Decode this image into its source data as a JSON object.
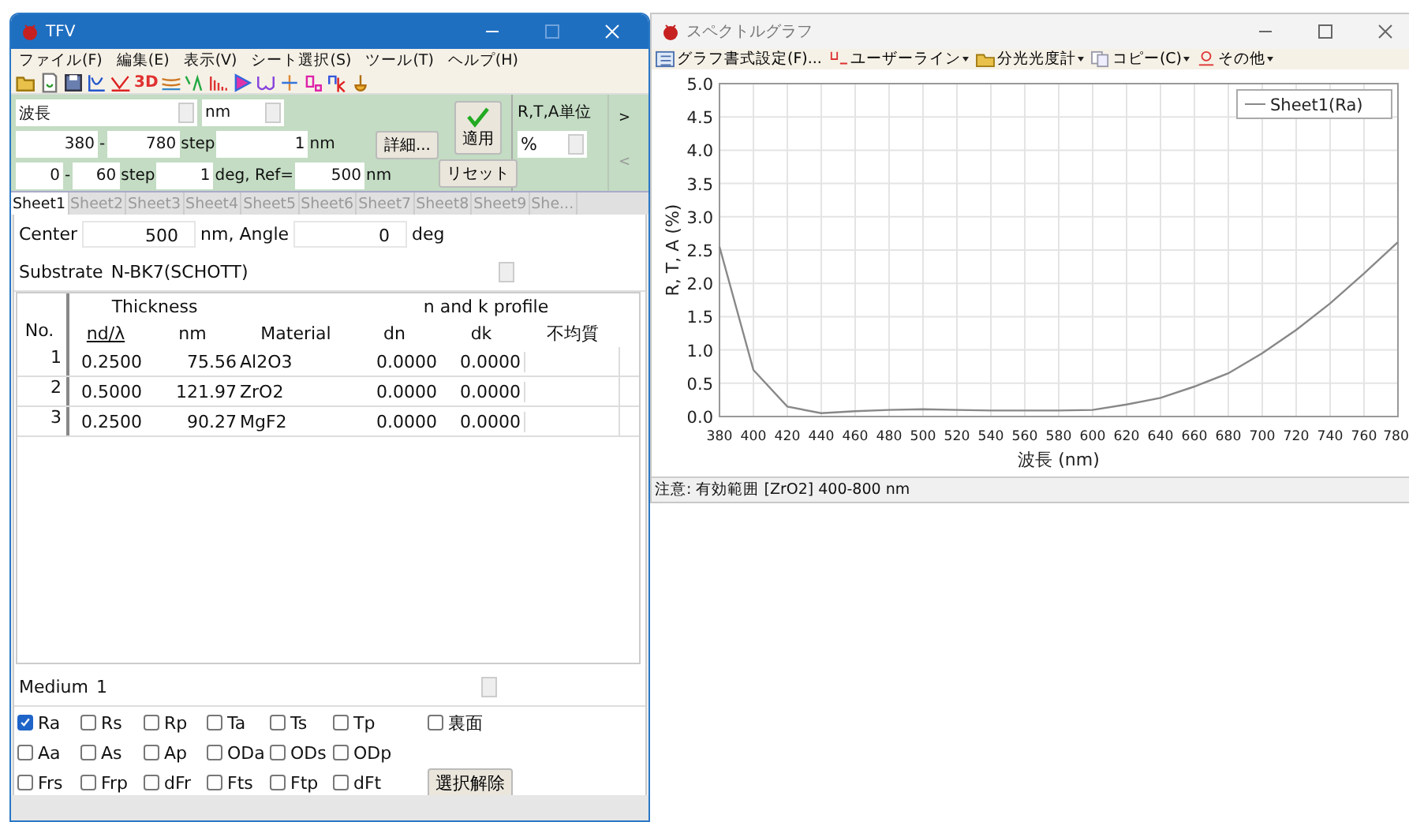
{
  "main_window": {
    "title": "TFV",
    "menu": [
      "ファイル(F)",
      "編集(E)",
      "表示(V)",
      "シート選択(S)",
      "ツール(T)",
      "ヘルプ(H)"
    ],
    "toolbar": {
      "text_icon": "3D"
    },
    "range_panel": {
      "axis_select": "波長",
      "unit_select": "nm",
      "from": "380",
      "dash_1": "-",
      "to": "780",
      "step_label_1": "step",
      "step": "1",
      "unit_1": "nm",
      "detail_button": "詳細...",
      "angle_from": "0",
      "dash_2": "-",
      "angle_to": "60",
      "step_label_2": "step",
      "angle_step": "1",
      "ref_label": "deg, Ref=",
      "ref": "500",
      "unit_2": "nm",
      "apply_button": "適用",
      "reset_button": "リセット",
      "units_label": "R,T,A単位",
      "units_select": "%",
      "expand_arrow": ">",
      "collapse_arrow": "<"
    },
    "tabs": [
      {
        "label": "Sheet1",
        "selected": true
      },
      {
        "label": "Sheet2",
        "selected": false
      },
      {
        "label": "Sheet3",
        "selected": false
      },
      {
        "label": "Sheet4",
        "selected": false
      },
      {
        "label": "Sheet5",
        "selected": false
      },
      {
        "label": "Sheet6",
        "selected": false
      },
      {
        "label": "Sheet7",
        "selected": false
      },
      {
        "label": "Sheet8",
        "selected": false
      },
      {
        "label": "Sheet9",
        "selected": false
      },
      {
        "label": "She...",
        "selected": false
      }
    ],
    "center_row": {
      "center_label": "Center",
      "center": "500",
      "angle_label": "nm, Angle",
      "angle": "0",
      "deg_label": "deg"
    },
    "substrate": {
      "label": "Substrate",
      "value": "N-BK7(SCHOTT)"
    },
    "layers_table": {
      "groups": [
        "Thickness",
        "n and k profile"
      ],
      "columns": [
        "No.",
        "nd/λ",
        "nm",
        "Material",
        "dn",
        "dk",
        "不均質"
      ],
      "rows": [
        [
          "1",
          "0.2500",
          "75.56",
          "Al2O3",
          "0.0000",
          "0.0000"
        ],
        [
          "2",
          "0.5000",
          "121.97",
          "ZrO2",
          "0.0000",
          "0.0000"
        ],
        [
          "3",
          "0.2500",
          "90.27",
          "MgF2",
          "0.0000",
          "0.0000"
        ]
      ]
    },
    "medium": {
      "label": "Medium",
      "value": "1"
    },
    "outputs": [
      [
        {
          "label": "Ra",
          "checked": true
        },
        {
          "label": "Rs",
          "checked": false
        },
        {
          "label": "Rp",
          "checked": false
        },
        {
          "label": "Ta",
          "checked": false
        },
        {
          "label": "Ts",
          "checked": false
        },
        {
          "label": "Tp",
          "checked": false
        }
      ],
      [
        {
          "label": "Aa",
          "checked": false
        },
        {
          "label": "As",
          "checked": false
        },
        {
          "label": "Ap",
          "checked": false
        },
        {
          "label": "ODa",
          "checked": false
        },
        {
          "label": "ODs",
          "checked": false
        },
        {
          "label": "ODp",
          "checked": false
        }
      ],
      [
        {
          "label": "Frs",
          "checked": false
        },
        {
          "label": "Frp",
          "checked": false
        },
        {
          "label": "dFr",
          "checked": false
        },
        {
          "label": "Fts",
          "checked": false
        },
        {
          "label": "Ftp",
          "checked": false
        },
        {
          "label": "dFt",
          "checked": false
        }
      ]
    ],
    "back_side": {
      "label": "裏面",
      "checked": false
    },
    "clear_button": "選択解除"
  },
  "graph_window": {
    "title": "スペクトルグラフ",
    "toolbar": [
      {
        "label": "グラフ書式設定(F)...",
        "dropdown": false
      },
      {
        "label": "ユーザーライン",
        "dropdown": true
      },
      {
        "label": "分光光度計",
        "dropdown": true
      },
      {
        "label": "コピー(C)",
        "dropdown": true
      },
      {
        "label": "その他",
        "dropdown": true
      }
    ],
    "chart_data": {
      "type": "line",
      "xlabel": "波長 (nm)",
      "ylabel": "R, T, A (%)",
      "x": [
        380,
        400,
        420,
        440,
        460,
        480,
        500,
        520,
        540,
        560,
        580,
        600,
        620,
        640,
        660,
        680,
        700,
        720,
        740,
        760,
        780
      ],
      "series": [
        {
          "name": "Sheet1(Ra)",
          "color": "#888888",
          "values": [
            2.55,
            0.7,
            0.15,
            0.05,
            0.08,
            0.1,
            0.11,
            0.1,
            0.09,
            0.09,
            0.09,
            0.1,
            0.18,
            0.28,
            0.45,
            0.65,
            0.95,
            1.3,
            1.7,
            2.15,
            2.62
          ]
        }
      ],
      "xlim": [
        380,
        780
      ],
      "ylim": [
        0,
        5
      ],
      "xticks": [
        380,
        400,
        420,
        440,
        460,
        480,
        500,
        520,
        540,
        560,
        580,
        600,
        620,
        640,
        660,
        680,
        700,
        720,
        740,
        760,
        780
      ],
      "grid": true,
      "yticks": [
        {
          "value": 0,
          "label": "0.0"
        },
        {
          "value": 0.5,
          "label": "0.5"
        },
        {
          "value": 1,
          "label": "1.0"
        },
        {
          "value": 1.5,
          "label": "1.5"
        },
        {
          "value": 2,
          "label": "2.0"
        },
        {
          "value": 2.5,
          "label": "2.5"
        },
        {
          "value": 3,
          "label": "3.0"
        },
        {
          "value": 3.5,
          "label": "3.5"
        },
        {
          "value": 4,
          "label": "4.0"
        },
        {
          "value": 4.5,
          "label": "4.5"
        },
        {
          "value": 5,
          "label": "5.0"
        }
      ]
    },
    "status": "注意: 有効範囲 [ZrO2] 400-800 nm"
  }
}
